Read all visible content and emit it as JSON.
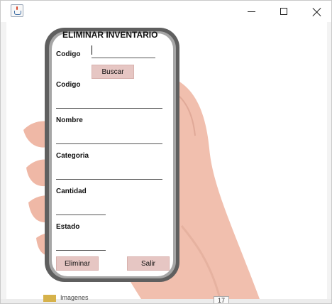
{
  "window": {
    "controls": {
      "minimize_icon": "minimize-icon",
      "maximize_icon": "maximize-icon",
      "close_icon": "close-icon"
    }
  },
  "form": {
    "title": "ELIMINAR INVENTARIO",
    "search_code_label": "Codigo",
    "search_code_value": "",
    "search_button": "Buscar",
    "result_code_label": "Codigo",
    "result_code_value": "",
    "name_label": "Nombre",
    "name_value": "",
    "category_label": "Categoria",
    "category_value": "",
    "quantity_label": "Cantidad",
    "quantity_value": "",
    "status_label": "Estado",
    "status_value": "",
    "delete_button": "Eliminar",
    "exit_button": "Salir"
  },
  "background": {
    "taskbar_label": "Imagenes",
    "line_number": "17",
    "colors": {
      "button": "#e6c6c3",
      "phone_frame": "#6b6b6b",
      "skin": "#f2c2b0"
    }
  }
}
